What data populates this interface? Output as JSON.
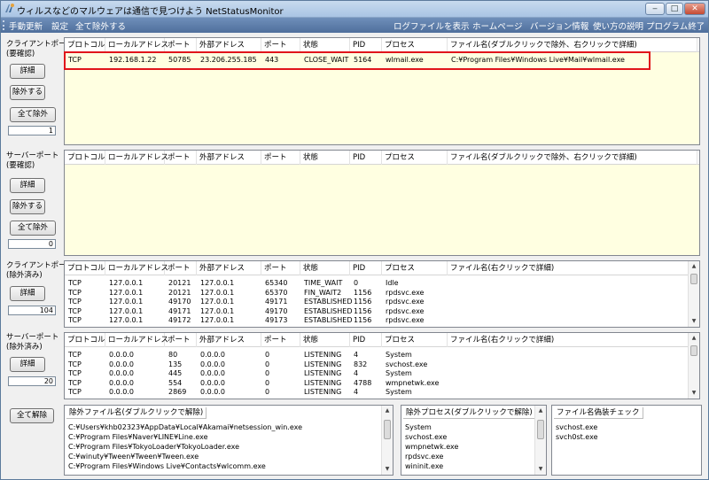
{
  "window": {
    "title": "ウィルスなどのマルウェアは通信で見つけよう NetStatusMonitor",
    "minimize": "‒",
    "maximize": "□",
    "close": "✕"
  },
  "menu": {
    "left": [
      "手動更新",
      "設定",
      "全て除外する"
    ],
    "right": [
      "ログファイルを表示",
      "ホームページ",
      "バージョン情報",
      "使い方の説明",
      "プログラム終了"
    ]
  },
  "columns_full": [
    "プロトコル",
    "ローカルアドレス",
    "ポート",
    "外部アドレス",
    "ポート",
    "状態",
    "PID",
    "プロセス",
    "ファイル名(ダブルクリックで除外、右クリックで詳細)"
  ],
  "columns_excluded": [
    "プロトコル",
    "ローカルアドレス",
    "ポート",
    "外部アドレス",
    "ポート",
    "状態",
    "PID",
    "プロセス",
    "ファイル名(右クリックで詳細)"
  ],
  "client_pending": {
    "label": "クライアントポート\n(要確認)",
    "detail_btn": "詳細",
    "exclude_btn": "除外する",
    "exclude_all_btn": "全て除外",
    "count": "1",
    "rows": [
      [
        "TCP",
        "192.168.1.22",
        "50785",
        "23.206.255.185",
        "443",
        "CLOSE_WAIT",
        "5164",
        "wlmail.exe",
        "C:¥Program Files¥Windows Live¥Mail¥wlmail.exe"
      ]
    ]
  },
  "server_pending": {
    "label": "サーバーポート\n(要確認)",
    "detail_btn": "詳細",
    "exclude_btn": "除外する",
    "exclude_all_btn": "全て除外",
    "count": "0",
    "rows": []
  },
  "client_excluded": {
    "label": "クライアントポート\n(除外済み)",
    "detail_btn": "詳細",
    "count": "104",
    "rows": [
      [
        "TCP",
        "127.0.0.1",
        "20121",
        "127.0.0.1",
        "65340",
        "TIME_WAIT",
        "0",
        "Idle",
        ""
      ],
      [
        "TCP",
        "127.0.0.1",
        "20121",
        "127.0.0.1",
        "65370",
        "FIN_WAIT2",
        "1156",
        "rpdsvc.exe",
        ""
      ],
      [
        "TCP",
        "127.0.0.1",
        "49170",
        "127.0.0.1",
        "49171",
        "ESTABLISHED",
        "1156",
        "rpdsvc.exe",
        ""
      ],
      [
        "TCP",
        "127.0.0.1",
        "49171",
        "127.0.0.1",
        "49170",
        "ESTABLISHED",
        "1156",
        "rpdsvc.exe",
        ""
      ],
      [
        "TCP",
        "127.0.0.1",
        "49172",
        "127.0.0.1",
        "49173",
        "ESTABLISHED",
        "1156",
        "rpdsvc.exe",
        ""
      ]
    ]
  },
  "server_excluded": {
    "label": "サーバーポート\n(除外済み)",
    "detail_btn": "詳細",
    "count": "20",
    "rows": [
      [
        "TCP",
        "0.0.0.0",
        "80",
        "0.0.0.0",
        "0",
        "LISTENING",
        "4",
        "System",
        ""
      ],
      [
        "TCP",
        "0.0.0.0",
        "135",
        "0.0.0.0",
        "0",
        "LISTENING",
        "832",
        "svchost.exe",
        ""
      ],
      [
        "TCP",
        "0.0.0.0",
        "445",
        "0.0.0.0",
        "0",
        "LISTENING",
        "4",
        "System",
        ""
      ],
      [
        "TCP",
        "0.0.0.0",
        "554",
        "0.0.0.0",
        "0",
        "LISTENING",
        "4788",
        "wmpnetwk.exe",
        ""
      ],
      [
        "TCP",
        "0.0.0.0",
        "2869",
        "0.0.0.0",
        "0",
        "LISTENING",
        "4",
        "System",
        ""
      ]
    ]
  },
  "bottom": {
    "clear_all_btn": "全て解除",
    "excluded_files": {
      "title": "除外ファイル名(ダブルクリックで解除)",
      "items": [
        "C:¥Users¥khb02323¥AppData¥Local¥Akamai¥netsession_win.exe",
        "C:¥Program Files¥Naver¥LINE¥Line.exe",
        "C:¥Program Files¥TokyoLoader¥TokyoLoader.exe",
        "C:¥winuty¥Tween¥Tween¥Tween.exe",
        "C:¥Program Files¥Windows Live¥Contacts¥wlcomm.exe"
      ]
    },
    "excluded_processes": {
      "title": "除外プロセス(ダブルクリックで解除)",
      "items": [
        "System",
        "svchost.exe",
        "wmpnetwk.exe",
        "rpdsvc.exe",
        "wininit.exe"
      ]
    },
    "fake_check": {
      "title": "ファイル名偽装チェック",
      "items": [
        "svchost.exe",
        "svch0st.exe"
      ]
    }
  }
}
